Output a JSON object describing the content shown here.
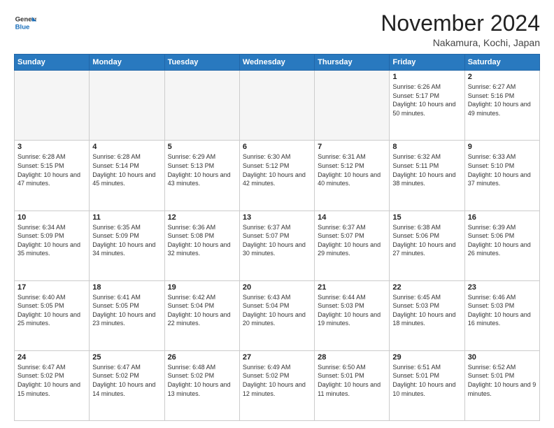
{
  "header": {
    "logo_line1": "General",
    "logo_line2": "Blue",
    "month": "November 2024",
    "location": "Nakamura, Kochi, Japan"
  },
  "days_of_week": [
    "Sunday",
    "Monday",
    "Tuesday",
    "Wednesday",
    "Thursday",
    "Friday",
    "Saturday"
  ],
  "weeks": [
    [
      {
        "day": "",
        "info": ""
      },
      {
        "day": "",
        "info": ""
      },
      {
        "day": "",
        "info": ""
      },
      {
        "day": "",
        "info": ""
      },
      {
        "day": "",
        "info": ""
      },
      {
        "day": "1",
        "info": "Sunrise: 6:26 AM\nSunset: 5:17 PM\nDaylight: 10 hours\nand 50 minutes."
      },
      {
        "day": "2",
        "info": "Sunrise: 6:27 AM\nSunset: 5:16 PM\nDaylight: 10 hours\nand 49 minutes."
      }
    ],
    [
      {
        "day": "3",
        "info": "Sunrise: 6:28 AM\nSunset: 5:15 PM\nDaylight: 10 hours\nand 47 minutes."
      },
      {
        "day": "4",
        "info": "Sunrise: 6:28 AM\nSunset: 5:14 PM\nDaylight: 10 hours\nand 45 minutes."
      },
      {
        "day": "5",
        "info": "Sunrise: 6:29 AM\nSunset: 5:13 PM\nDaylight: 10 hours\nand 43 minutes."
      },
      {
        "day": "6",
        "info": "Sunrise: 6:30 AM\nSunset: 5:12 PM\nDaylight: 10 hours\nand 42 minutes."
      },
      {
        "day": "7",
        "info": "Sunrise: 6:31 AM\nSunset: 5:12 PM\nDaylight: 10 hours\nand 40 minutes."
      },
      {
        "day": "8",
        "info": "Sunrise: 6:32 AM\nSunset: 5:11 PM\nDaylight: 10 hours\nand 38 minutes."
      },
      {
        "day": "9",
        "info": "Sunrise: 6:33 AM\nSunset: 5:10 PM\nDaylight: 10 hours\nand 37 minutes."
      }
    ],
    [
      {
        "day": "10",
        "info": "Sunrise: 6:34 AM\nSunset: 5:09 PM\nDaylight: 10 hours\nand 35 minutes."
      },
      {
        "day": "11",
        "info": "Sunrise: 6:35 AM\nSunset: 5:09 PM\nDaylight: 10 hours\nand 34 minutes."
      },
      {
        "day": "12",
        "info": "Sunrise: 6:36 AM\nSunset: 5:08 PM\nDaylight: 10 hours\nand 32 minutes."
      },
      {
        "day": "13",
        "info": "Sunrise: 6:37 AM\nSunset: 5:07 PM\nDaylight: 10 hours\nand 30 minutes."
      },
      {
        "day": "14",
        "info": "Sunrise: 6:37 AM\nSunset: 5:07 PM\nDaylight: 10 hours\nand 29 minutes."
      },
      {
        "day": "15",
        "info": "Sunrise: 6:38 AM\nSunset: 5:06 PM\nDaylight: 10 hours\nand 27 minutes."
      },
      {
        "day": "16",
        "info": "Sunrise: 6:39 AM\nSunset: 5:06 PM\nDaylight: 10 hours\nand 26 minutes."
      }
    ],
    [
      {
        "day": "17",
        "info": "Sunrise: 6:40 AM\nSunset: 5:05 PM\nDaylight: 10 hours\nand 25 minutes."
      },
      {
        "day": "18",
        "info": "Sunrise: 6:41 AM\nSunset: 5:05 PM\nDaylight: 10 hours\nand 23 minutes."
      },
      {
        "day": "19",
        "info": "Sunrise: 6:42 AM\nSunset: 5:04 PM\nDaylight: 10 hours\nand 22 minutes."
      },
      {
        "day": "20",
        "info": "Sunrise: 6:43 AM\nSunset: 5:04 PM\nDaylight: 10 hours\nand 20 minutes."
      },
      {
        "day": "21",
        "info": "Sunrise: 6:44 AM\nSunset: 5:03 PM\nDaylight: 10 hours\nand 19 minutes."
      },
      {
        "day": "22",
        "info": "Sunrise: 6:45 AM\nSunset: 5:03 PM\nDaylight: 10 hours\nand 18 minutes."
      },
      {
        "day": "23",
        "info": "Sunrise: 6:46 AM\nSunset: 5:03 PM\nDaylight: 10 hours\nand 16 minutes."
      }
    ],
    [
      {
        "day": "24",
        "info": "Sunrise: 6:47 AM\nSunset: 5:02 PM\nDaylight: 10 hours\nand 15 minutes."
      },
      {
        "day": "25",
        "info": "Sunrise: 6:47 AM\nSunset: 5:02 PM\nDaylight: 10 hours\nand 14 minutes."
      },
      {
        "day": "26",
        "info": "Sunrise: 6:48 AM\nSunset: 5:02 PM\nDaylight: 10 hours\nand 13 minutes."
      },
      {
        "day": "27",
        "info": "Sunrise: 6:49 AM\nSunset: 5:02 PM\nDaylight: 10 hours\nand 12 minutes."
      },
      {
        "day": "28",
        "info": "Sunrise: 6:50 AM\nSunset: 5:01 PM\nDaylight: 10 hours\nand 11 minutes."
      },
      {
        "day": "29",
        "info": "Sunrise: 6:51 AM\nSunset: 5:01 PM\nDaylight: 10 hours\nand 10 minutes."
      },
      {
        "day": "30",
        "info": "Sunrise: 6:52 AM\nSunset: 5:01 PM\nDaylight: 10 hours\nand 9 minutes."
      }
    ]
  ]
}
